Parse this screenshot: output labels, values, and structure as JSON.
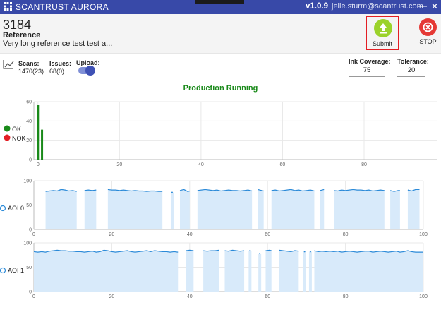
{
  "titlebar": {
    "app_name": "SCANTRUST AURORA",
    "version": "v1.0.9",
    "user": "jelle.sturm@scantrust.com",
    "minimize": "—",
    "close": "✕"
  },
  "reference": {
    "id": "3184",
    "label": "Reference",
    "description": "Very long reference test test a..."
  },
  "actions": {
    "submit_label": "Submit",
    "stop_label": "STOP"
  },
  "metrics": {
    "scans_label": "Scans:",
    "scans_value": "1470(23)",
    "issues_label": "Issues:",
    "issues_value": "68(0)",
    "upload_label": "Upload:",
    "upload_on": true,
    "ink_label": "Ink Coverage:",
    "ink_value": "75",
    "tolerance_label": "Tolerance:",
    "tolerance_value": "20"
  },
  "status": {
    "text": "Production Running",
    "color": "#1a8a1a"
  },
  "legend": {
    "ok_label": "OK",
    "nok_label": "NOK",
    "ok_color": "#1a8a1a",
    "nok_color": "#e31e24"
  },
  "aoi": {
    "aoi0_label": "AOI 0",
    "aoi1_label": "AOI 1"
  },
  "chart_data": [
    {
      "type": "bar",
      "x": [
        0,
        1
      ],
      "series": [
        {
          "name": "OK",
          "values": [
            57,
            31
          ],
          "color": "#1a8a1a"
        },
        {
          "name": "NOK",
          "values": [
            0,
            0
          ],
          "color": "#e31e24"
        }
      ],
      "xlim": [
        -1,
        98
      ],
      "ylim": [
        0,
        60
      ],
      "xticks": [
        0,
        20,
        40,
        60,
        80
      ],
      "yticks": [
        0,
        20,
        40,
        60
      ],
      "grid": true
    },
    {
      "type": "area",
      "series_label": "AOI 0",
      "xlim": [
        0,
        100
      ],
      "ylim": [
        0,
        100
      ],
      "xticks": [
        0,
        20,
        40,
        60,
        80,
        100
      ],
      "yticks": [
        0,
        50,
        100
      ],
      "grid": true,
      "color": "#2b8ad8",
      "segments": [
        {
          "x": [
            3,
            4,
            5,
            6,
            7,
            8,
            9,
            10,
            11
          ],
          "y": [
            78,
            79,
            80,
            79,
            82,
            81,
            79,
            80,
            78
          ]
        },
        {
          "x": [
            13,
            14,
            15,
            16
          ],
          "y": [
            80,
            81,
            80,
            81
          ]
        },
        {
          "x": [
            19,
            20,
            21,
            22,
            23,
            24,
            25,
            26,
            27,
            28,
            29,
            30,
            31,
            32,
            33
          ],
          "y": [
            82,
            81,
            81,
            80,
            81,
            80,
            79,
            80,
            79,
            79,
            78,
            79,
            79,
            78,
            78
          ]
        },
        {
          "x": [
            35.5
          ],
          "y": [
            76
          ]
        },
        {
          "x": [
            37.5,
            38.5,
            39.5,
            40
          ],
          "y": [
            80,
            82,
            78,
            79
          ]
        },
        {
          "x": [
            42,
            43,
            44,
            45,
            46,
            47,
            48,
            49,
            50,
            51,
            52,
            53,
            54,
            55,
            56
          ],
          "y": [
            80,
            81,
            82,
            81,
            80,
            81,
            79,
            80,
            81,
            80,
            80,
            79,
            80,
            81,
            79
          ]
        },
        {
          "x": [
            57.5,
            58.5,
            59
          ],
          "y": [
            82,
            80,
            79
          ]
        },
        {
          "x": [
            61,
            62,
            63,
            64,
            65,
            66,
            67,
            68,
            69,
            70,
            71,
            72
          ],
          "y": [
            80,
            81,
            79,
            80,
            81,
            82,
            80,
            81,
            79,
            80,
            81,
            79
          ]
        },
        {
          "x": [
            73.5,
            74.5
          ],
          "y": [
            80,
            82
          ]
        },
        {
          "x": [
            77,
            78,
            79,
            80,
            81,
            82,
            83,
            84,
            85,
            86,
            87,
            88,
            89,
            90
          ],
          "y": [
            80,
            79,
            81,
            80,
            81,
            82,
            81,
            81,
            80,
            81,
            79,
            80,
            81,
            80
          ]
        },
        {
          "x": [
            91.5,
            92.5,
            93.5,
            94
          ],
          "y": [
            80,
            78,
            80,
            80
          ]
        },
        {
          "x": [
            96,
            97,
            98,
            99
          ],
          "y": [
            81,
            79,
            82,
            82
          ]
        }
      ]
    },
    {
      "type": "area",
      "series_label": "AOI 1",
      "xlim": [
        0,
        100
      ],
      "ylim": [
        0,
        100
      ],
      "xticks": [
        0,
        20,
        40,
        60,
        80,
        100
      ],
      "yticks": [
        0,
        50,
        100
      ],
      "grid": true,
      "color": "#2b8ad8",
      "segments": [
        {
          "x": [
            0,
            1,
            2,
            3,
            4,
            5,
            6,
            7,
            8,
            9,
            10,
            11,
            12,
            13,
            14,
            15,
            16,
            17,
            18,
            19,
            20,
            21,
            22,
            23,
            24,
            25,
            26,
            27,
            28,
            29,
            30,
            31,
            32,
            33,
            34,
            35,
            36,
            37
          ],
          "y": [
            82,
            81,
            82,
            81,
            83,
            84,
            85,
            84,
            84,
            83,
            83,
            82,
            82,
            81,
            82,
            83,
            81,
            82,
            85,
            84,
            82,
            81,
            82,
            83,
            84,
            82,
            81,
            82,
            83,
            84,
            82,
            84,
            83,
            82,
            82,
            81,
            82,
            81
          ]
        },
        {
          "x": [
            39,
            40,
            41
          ],
          "y": [
            84,
            85,
            84
          ]
        },
        {
          "x": [
            43.5,
            44.5,
            45.5,
            46.5,
            47.5
          ],
          "y": [
            84,
            83,
            84,
            84,
            85
          ]
        },
        {
          "x": [
            49,
            50,
            51,
            52,
            53,
            54
          ],
          "y": [
            84,
            83,
            85,
            84,
            83,
            84
          ]
        },
        {
          "x": [
            55.5
          ],
          "y": [
            84
          ]
        },
        {
          "x": [
            58
          ],
          "y": [
            78
          ]
        },
        {
          "x": [
            59.5,
            60.5,
            61
          ],
          "y": [
            84,
            85,
            84
          ]
        },
        {
          "x": [
            63,
            64,
            65,
            66,
            67,
            68
          ],
          "y": [
            85,
            84,
            83,
            82,
            84,
            83
          ]
        },
        {
          "x": [
            69.5
          ],
          "y": [
            82
          ]
        },
        {
          "x": [
            71
          ],
          "y": [
            82
          ]
        },
        {
          "x": [
            72,
            73,
            74,
            75,
            76,
            77,
            78,
            79,
            80,
            81,
            82,
            83,
            84,
            85,
            86,
            87,
            88,
            89,
            90,
            91,
            92,
            93,
            94,
            95,
            96,
            97,
            98,
            99,
            100
          ],
          "y": [
            84,
            82,
            83,
            82,
            83,
            82,
            83,
            81,
            82,
            83,
            82,
            81,
            82,
            83,
            83,
            81,
            82,
            83,
            82,
            81,
            82,
            83,
            81,
            82,
            84,
            82,
            81,
            81,
            81
          ]
        }
      ]
    }
  ]
}
